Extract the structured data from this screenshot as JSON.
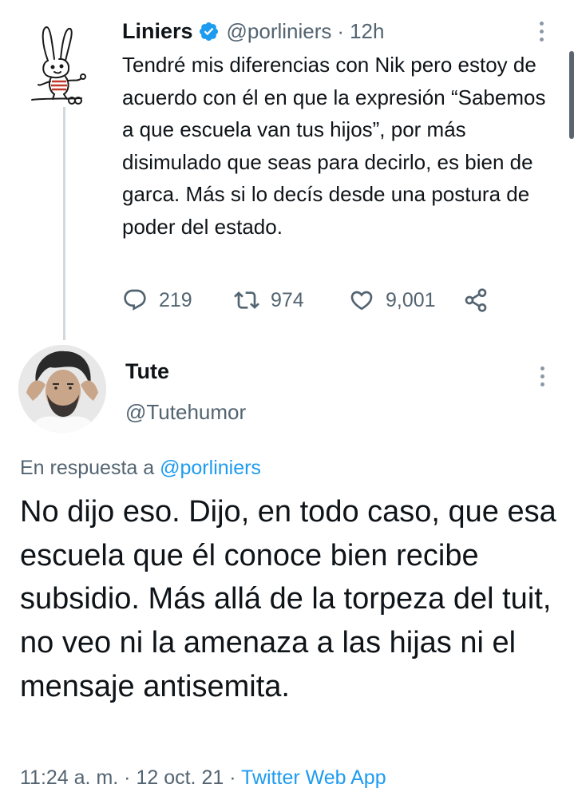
{
  "parent_tweet": {
    "author_name": "Liniers",
    "author_handle": "@porliniers",
    "separator": "·",
    "time": "12h",
    "text": "Tendré mis diferencias con Nik pero estoy de acuerdo con él en que la expresión “Sabemos a que escuela van tus hijos”, por más disimulado que seas para decirlo, es bien de garca. Más si lo decís desde una postura de poder del estado.",
    "replies": "219",
    "retweets": "974",
    "likes": "9,001"
  },
  "main_tweet": {
    "author_name": "Tute",
    "author_handle": "@Tutehumor",
    "reply_prefix": "En respuesta a",
    "reply_handle": "@porliniers",
    "text": "No dijo eso. Dijo, en todo caso, que esa escuela que él conoce bien recibe subsidio. Más allá de la torpeza del tuit, no veo ni la amenaza a las hijas ni el mensaje antisemita.",
    "time": "11:24 a. m.",
    "sep1": "·",
    "date": "12 oct. 21",
    "sep2": "·",
    "source": "Twitter Web App"
  },
  "colors": {
    "accent": "#1d9bf0",
    "secondary_text": "#536471",
    "primary_text": "#0f1419",
    "thread_line": "#cfd9de"
  },
  "icons": [
    "verified-badge-icon",
    "more-options-icon",
    "reply-icon",
    "retweet-icon",
    "like-icon",
    "share-icon"
  ]
}
